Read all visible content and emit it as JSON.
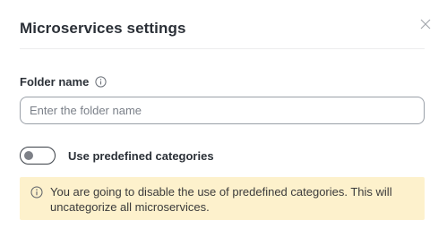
{
  "dialog": {
    "title": "Microservices settings",
    "close_icon": "close-icon"
  },
  "folder": {
    "label": "Folder name",
    "info_icon": "info-icon",
    "placeholder": "Enter the folder name",
    "value": ""
  },
  "toggle": {
    "label": "Use predefined categories",
    "state": "off"
  },
  "warning": {
    "icon": "info-icon",
    "text": "You are going to disable the use of predefined categories. This will uncategorize all microservices.",
    "background": "#fdf1cc"
  }
}
